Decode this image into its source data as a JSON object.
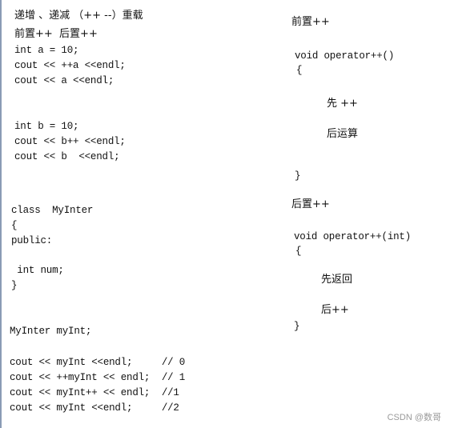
{
  "left": {
    "title": "递增 、递减 （++ --）重载",
    "subtitle": "前置++  后置++",
    "block_a": [
      "int a = 10;",
      "cout << ++a <<endl;",
      "cout << a <<endl;"
    ],
    "block_b": [
      "int b = 10;",
      "cout << b++ <<endl;",
      "cout << b  <<endl;"
    ],
    "class_block": [
      "class  MyInter",
      "{",
      "public:",
      " int num;",
      "}"
    ],
    "decl": "MyInter myInt;",
    "output_block": [
      "cout << myInt <<endl;     // 0",
      "cout << ++myInt << endl;  // 1",
      "cout << myInt++ << endl;  //1",
      "cout << myInt <<endl;     //2"
    ]
  },
  "right": {
    "prefix": {
      "heading": "前置++",
      "signature": "void operator++()",
      "open_brace": "{",
      "step1": "先 ++",
      "step2": "后运算",
      "close_brace": "}"
    },
    "postfix": {
      "heading": "后置++",
      "signature": "void operator++(int)",
      "open_brace": "{",
      "step1": "先返回",
      "step2": "后++",
      "close_brace": "}"
    }
  },
  "watermark": "CSDN @数哥"
}
